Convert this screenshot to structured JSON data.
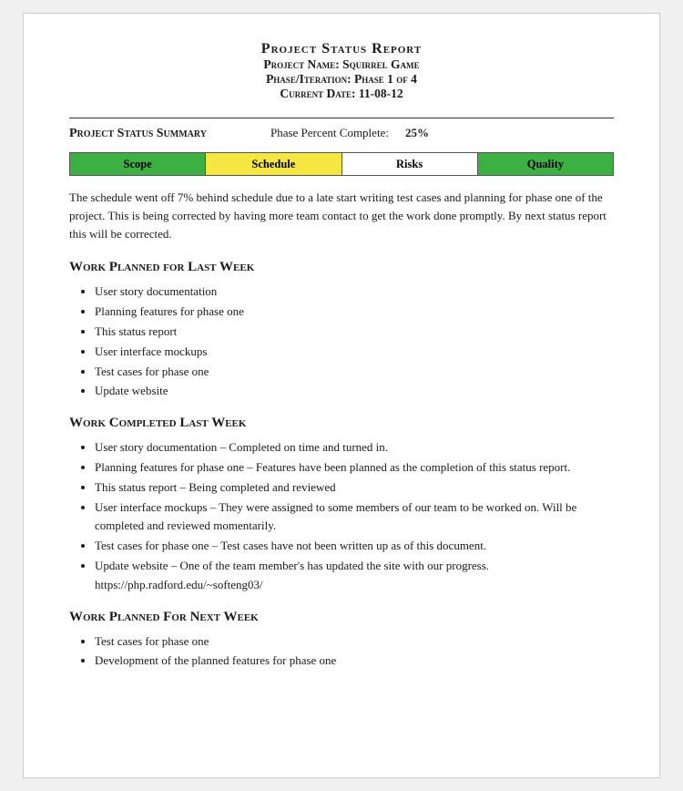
{
  "header": {
    "title": "Project Status Report",
    "line1": "Project Name: Squirrel Game",
    "line2": "Phase/Iteration: Phase 1 of 4",
    "line3": "Current Date: 11-08-12"
  },
  "status_summary": {
    "label": "Project Status Summary",
    "phase_complete_label": "Phase Percent Complete:",
    "phase_complete_value": "25%"
  },
  "status_bar": [
    {
      "label": "Scope",
      "color": "green"
    },
    {
      "label": "Schedule",
      "color": "yellow"
    },
    {
      "label": "Risks",
      "color": "white-bg"
    },
    {
      "label": "Quality",
      "color": "green"
    }
  ],
  "description": "The schedule went off 7% behind schedule due to a late start writing test cases and planning for phase one of the project. This is being corrected by having more team contact to get the work done promptly. By next status report this will be corrected.",
  "work_planned_last_week": {
    "title": "Work Planned for Last Week",
    "items": [
      "User story documentation",
      "Planning features for phase one",
      "This status report",
      "User interface mockups",
      "Test cases for phase one",
      "Update website"
    ]
  },
  "work_completed_last_week": {
    "title": "Work Completed Last Week",
    "items": [
      "User story documentation – Completed on time and turned in.",
      "Planning features for phase one – Features have been planned as the completion of this status report.",
      "This status report – Being completed and reviewed",
      "User interface mockups – They were assigned to some members of our team to be worked on. Will be completed and reviewed momentarily.",
      "Test cases for phase one – Test cases have not been written up as of this document.",
      "Update website – One of the team member's has updated the site with our progress. https://php.radford.edu/~softeng03/"
    ]
  },
  "work_planned_next_week": {
    "title": "Work Planned For Next Week",
    "items": [
      "Test cases for phase one",
      "Development of the planned features for phase one"
    ]
  }
}
